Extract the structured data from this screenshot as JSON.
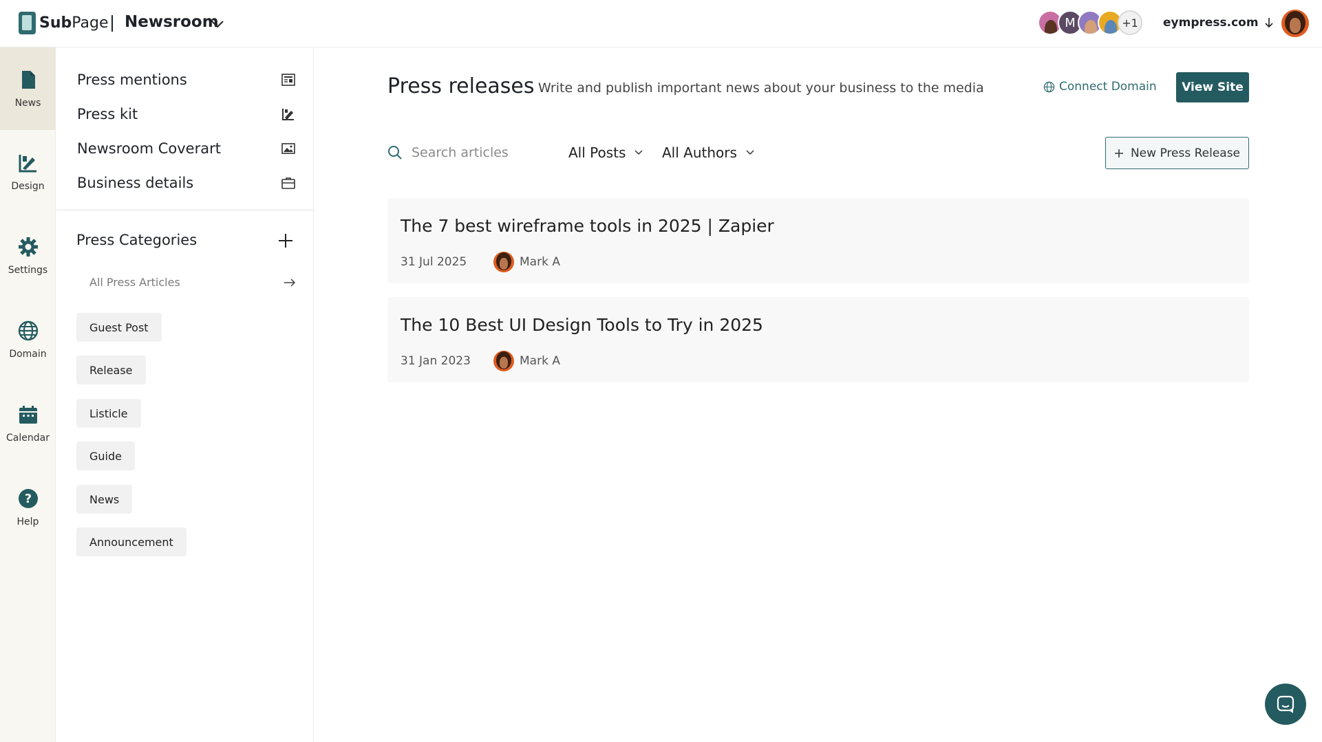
{
  "header": {
    "logo_sub": "Sub",
    "logo_page": "Page",
    "workspace_title": "Newsroom",
    "avatars_more": "+1",
    "avatar_m": "M",
    "domain_label": "eympress.com"
  },
  "rail": {
    "items": [
      {
        "label": "News",
        "icon": "document-icon"
      },
      {
        "label": "Design",
        "icon": "design-icon"
      },
      {
        "label": "Settings",
        "icon": "gear-icon"
      },
      {
        "label": "Domain",
        "icon": "globe-icon"
      },
      {
        "label": "Calendar",
        "icon": "calendar-icon"
      },
      {
        "label": "Help",
        "icon": "help-icon"
      }
    ]
  },
  "sidebar": {
    "menu": [
      {
        "label": "Press mentions",
        "icon": "newspaper-icon"
      },
      {
        "label": "Press kit",
        "icon": "press-kit-icon"
      },
      {
        "label": "Newsroom Coverart",
        "icon": "image-icon"
      },
      {
        "label": "Business details",
        "icon": "briefcase-icon"
      }
    ],
    "categories_title": "Press Categories",
    "all_articles": "All Press Articles",
    "chips": [
      "Guest Post",
      "Release",
      "Listicle",
      "Guide",
      "News",
      "Announcement"
    ]
  },
  "main": {
    "title": "Press releases",
    "subtitle": "Write and publish important news about your business to the media",
    "connect_domain": "Connect Domain",
    "view_site": "View Site",
    "search_placeholder": "Search articles",
    "filter_posts": "All Posts",
    "filter_authors": "All Authors",
    "new_release": "New Press Release",
    "articles": [
      {
        "title": "The 7 best wireframe tools in 2025 | Zapier",
        "date": "31 Jul 2025",
        "author": "Mark A"
      },
      {
        "title": "The 10 Best UI Design Tools to Try in 2025",
        "date": "31 Jan 2023",
        "author": "Mark A"
      }
    ]
  },
  "colors": {
    "accent": "#245b60",
    "rail_bg": "#f8f7f2",
    "rail_active": "#ece7db"
  }
}
